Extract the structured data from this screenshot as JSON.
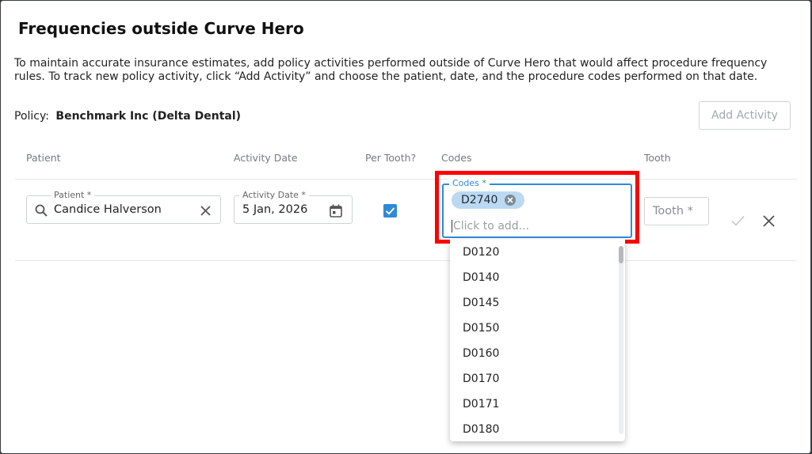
{
  "dialog": {
    "title": "Frequencies outside Curve Hero",
    "description": "To maintain accurate insurance estimates, add policy activities performed outside of Curve Hero that would affect procedure frequency rules. To track new policy activity, click “Add Activity” and choose the patient, date, and the procedure codes performed on that date.",
    "policy_label": "Policy:",
    "policy_name": "Benchmark Inc (Delta Dental)",
    "add_activity_label": "Add Activity"
  },
  "table": {
    "headers": {
      "patient": "Patient",
      "activity_date": "Activity Date",
      "per_tooth": "Per Tooth?",
      "codes": "Codes",
      "tooth": "Tooth"
    }
  },
  "row": {
    "patient_label": "Patient *",
    "patient_value": "Candice Halverson",
    "date_label": "Activity Date *",
    "date_value": "5 Jan, 2026",
    "per_tooth_checked": true,
    "codes_label": "Codes *",
    "selected_codes": [
      "D2740"
    ],
    "codes_placeholder": "Click to add...",
    "tooth_placeholder": "Tooth *"
  },
  "dropdown": {
    "options": [
      "D0120",
      "D0140",
      "D0145",
      "D0150",
      "D0160",
      "D0170",
      "D0171",
      "D0180"
    ]
  },
  "colors": {
    "accent": "#2f8ad6",
    "chip": "#bcd9f2",
    "highlight": "#ff0000"
  },
  "icons": {
    "search": "search-icon",
    "clear": "close-icon",
    "calendar": "calendar-icon",
    "check": "check-icon",
    "chip_remove": "circle-x-icon"
  }
}
